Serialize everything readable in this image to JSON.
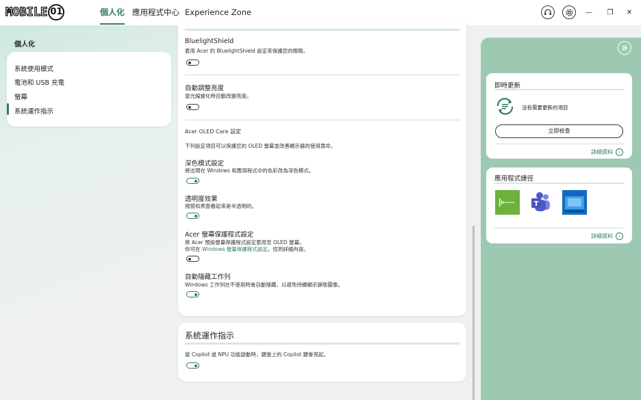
{
  "logo": {
    "text": "MOBILE",
    "ring_text": "01"
  },
  "nav": {
    "tabs": [
      {
        "label": "個人化",
        "active": true
      },
      {
        "label": "應用程式中心",
        "active": false
      },
      {
        "label": "Experience Zone",
        "active": false
      }
    ]
  },
  "window_controls": {
    "minimize": "—",
    "restore": "❐",
    "close": "✕"
  },
  "sidebar": {
    "title": "個人化",
    "items": [
      {
        "label": "系統使用模式"
      },
      {
        "label": "電池和 USB 充電"
      },
      {
        "label": "螢幕"
      },
      {
        "label": "系統運作指示",
        "active": true
      }
    ]
  },
  "main": {
    "settings": [
      {
        "title": "BluelightShield",
        "desc": "套用 Acer 的 BluelightShield 設定來保護您的眼睛。",
        "enabled": false
      },
      {
        "title": "自動調整亮度",
        "desc": "當光線變化時自動改變亮度。",
        "enabled": false
      }
    ],
    "oled_section": {
      "heading": "Acer OLED Care 設定",
      "intro": "下列設定項目可以保護您的 OLED 螢幕並改善顯示器的使用壽命。",
      "items": [
        {
          "title": "深色模式設定",
          "desc": "將出現在 Windows 和應用程式中的色彩改為深色模式。",
          "enabled": true
        },
        {
          "title": "透明度效果",
          "desc": "視窗和表面看起來是半透明的。",
          "enabled": true
        },
        {
          "title": "Acer 螢幕保護程式設定",
          "desc": "將 Acer 預設螢幕保護程式設定套用至 OLED 螢幕。",
          "desc2_prefix": "你可在",
          "desc2_link": "Windows 螢幕保護程式設定",
          "desc2_suffix": "。找到詳細內容。",
          "enabled": false
        },
        {
          "title": "自動隱藏工作列",
          "desc": "Windows 工作列在不使用時會自動隱藏，以避免持續顯示靜態圖像。",
          "enabled": true
        }
      ]
    },
    "indicator_section": {
      "title": "系統運作指示",
      "desc": "當 Copilot 或 NPU 功能啟動時，鍵盤上的 Copilot 鍵會亮起。",
      "enabled": true
    }
  },
  "right_panel": {
    "update_card": {
      "title": "即時更新",
      "status": "沒有需要更新的項目",
      "button": "立即檢查",
      "more": "詳細資料"
    },
    "shortcuts_card": {
      "title": "應用程式捷徑",
      "apps": [
        {
          "name": "audio-app-icon"
        },
        {
          "name": "teams-icon"
        },
        {
          "name": "window-app-icon"
        }
      ],
      "more": "詳細資料"
    }
  },
  "colors": {
    "accent": "#2e7d5b",
    "panel": "#9dc9b3"
  }
}
